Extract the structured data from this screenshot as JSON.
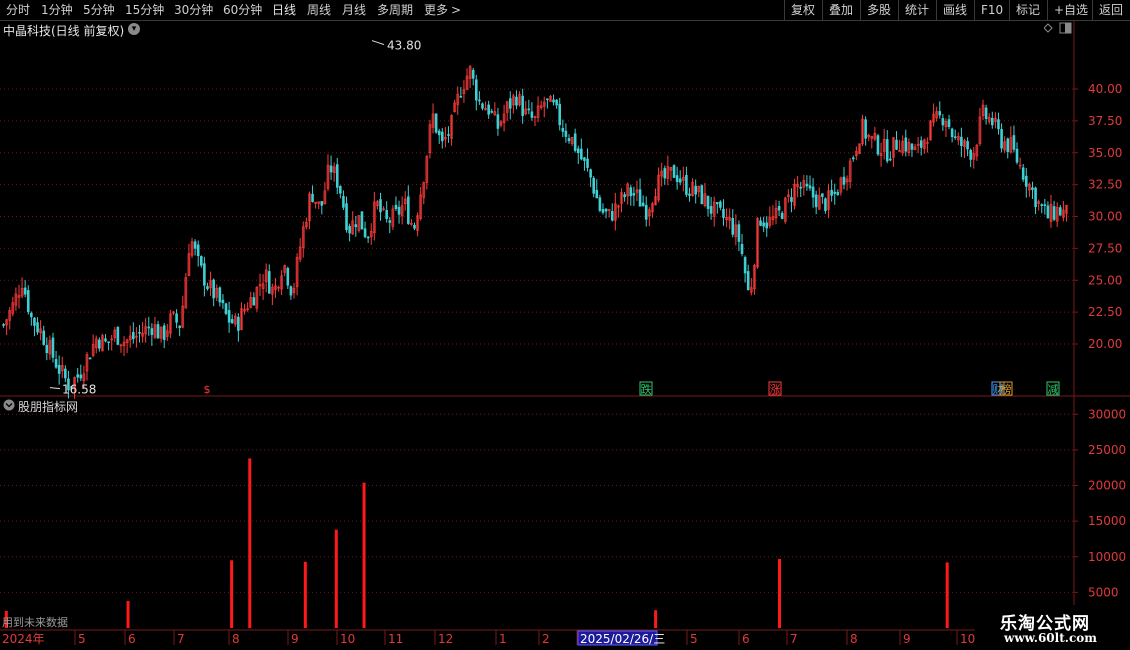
{
  "toolbar": {
    "left_items": [
      "分时",
      "1分钟",
      "5分钟",
      "15分钟",
      "30分钟",
      "60分钟",
      "日线",
      "周线",
      "月线",
      "多周期",
      "更多"
    ],
    "active": "日线",
    "more_arrow": ">",
    "right_items": [
      "复权",
      "叠加",
      "多股",
      "统计",
      "画线",
      "F10",
      "标记",
      "+自选",
      "返回"
    ]
  },
  "chart_header": {
    "title": "中晶科技(日线 前复权)"
  },
  "indicator_header": {
    "title": "股朋指标网"
  },
  "future_note": "用到未来数据",
  "logo": {
    "title": "乐淘公式网",
    "url": "www.60lt.com"
  },
  "colors": {
    "up": "#ff3b3b",
    "down": "#3fd0d4",
    "grid": "#6a1a1a",
    "axis_text": "#e03a3a",
    "volume_bar": "#ff1a1a"
  },
  "chart_data": [
    {
      "type": "candlestick",
      "title": "中晶科技(日线 前复权)",
      "ylim": [
        16,
        44
      ],
      "y_ticks": [
        20.0,
        22.5,
        25.0,
        27.5,
        30.0,
        32.5,
        35.0,
        37.5,
        40.0
      ],
      "y_tick_labels": [
        "20.00",
        "22.50",
        "25.00",
        "27.50",
        "30.00",
        "32.50",
        "35.00",
        "37.50",
        "40.00"
      ],
      "annotations": [
        {
          "label": "43.80",
          "type": "high"
        },
        {
          "label": "16.58",
          "type": "low"
        }
      ],
      "signals": [
        {
          "label": "$",
          "color": "#ff3b3b"
        },
        {
          "label": "跌",
          "color": "#2ecc71"
        },
        {
          "label": "涨",
          "color": "#ff3b3b"
        },
        {
          "label": "财",
          "color": "#4aa3ff"
        },
        {
          "label": "榜",
          "color": "#e0a020"
        },
        {
          "label": "减",
          "color": "#2ecc71"
        }
      ],
      "close_path": [
        21.5,
        23.0,
        25.0,
        22.0,
        21.0,
        19.5,
        18.0,
        16.8,
        17.5,
        19.0,
        20.5,
        20.0,
        20.8,
        20.2,
        20.5,
        21.0,
        21.5,
        20.5,
        22.0,
        21.5,
        28.5,
        26.0,
        24.5,
        23.5,
        22.0,
        21.5,
        23.0,
        24.0,
        25.5,
        24.0,
        26.5,
        24.0,
        28.5,
        32.0,
        30.5,
        34.0,
        32.5,
        29.0,
        30.0,
        28.5,
        31.0,
        29.5,
        30.0,
        31.0,
        29.0,
        33.0,
        38.0,
        35.5,
        37.0,
        40.0,
        41.5,
        39.0,
        38.5,
        37.0,
        38.5,
        39.5,
        38.0,
        37.5,
        39.0,
        38.5,
        37.0,
        36.0,
        34.5,
        33.0,
        30.5,
        30.0,
        31.0,
        32.0,
        31.5,
        30.5,
        32.5,
        33.0,
        33.5,
        32.5,
        32.0,
        31.5,
        30.5,
        30.0,
        29.5,
        28.0,
        23.5,
        30.0,
        29.5,
        30.0,
        31.0,
        32.5,
        32.0,
        31.5,
        31.0,
        31.5,
        33.0,
        34.5,
        37.0,
        36.0,
        35.5,
        35.0,
        36.0,
        35.5,
        35.0,
        36.5,
        37.5,
        38.0,
        36.0,
        35.5,
        35.0,
        38.0,
        37.5,
        36.0,
        35.5,
        34.0,
        32.5,
        31.0,
        30.0,
        30.5,
        30.2
      ]
    },
    {
      "type": "bar",
      "title": "股朋指标网",
      "ylim": [
        0,
        32000
      ],
      "y_ticks": [
        5000,
        10000,
        15000,
        20000,
        25000,
        30000
      ],
      "y_tick_labels": [
        "5000",
        "10000",
        "15000",
        "20000",
        "25000",
        "30000"
      ],
      "bars": [
        {
          "pos": 0.004,
          "value": 2400
        },
        {
          "pos": 0.118,
          "value": 3800
        },
        {
          "pos": 0.215,
          "value": 9500
        },
        {
          "pos": 0.232,
          "value": 23800
        },
        {
          "pos": 0.284,
          "value": 9300
        },
        {
          "pos": 0.313,
          "value": 13800
        },
        {
          "pos": 0.339,
          "value": 20400
        },
        {
          "pos": 0.612,
          "value": 2500
        },
        {
          "pos": 0.728,
          "value": 9700
        },
        {
          "pos": 0.885,
          "value": 9200
        }
      ],
      "x_ticks": [
        "2024年",
        "5",
        "6",
        "7",
        "8",
        "9",
        "10",
        "11",
        "12",
        "1",
        "2",
        "2025/02/26/三",
        "5",
        "6",
        "7",
        "8",
        "9",
        "10"
      ]
    }
  ]
}
